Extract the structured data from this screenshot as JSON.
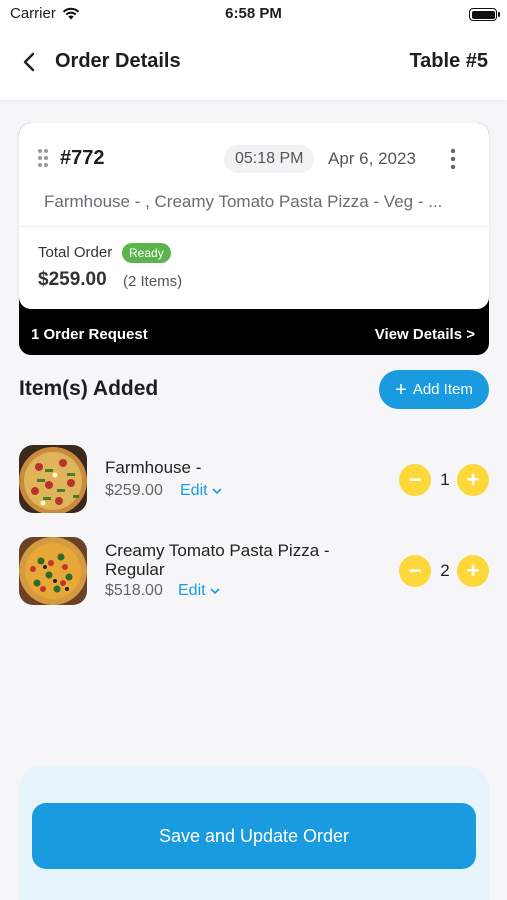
{
  "status_bar": {
    "carrier": "Carrier",
    "time": "6:58 PM"
  },
  "header": {
    "title": "Order Details",
    "table": "Table #5"
  },
  "order": {
    "number": "#772",
    "time": "05:18 PM",
    "date": "Apr 6, 2023",
    "items_summary": "Farmhouse - , Creamy Tomato Pasta Pizza - Veg - ...",
    "total_label": "Total Order",
    "status_badge": "Ready",
    "total_amount": "$259.00",
    "item_count": "(2 Items)",
    "request_label": "1 Order Request",
    "view_details": "View Details >"
  },
  "section": {
    "title": "Item(s) Added",
    "add_button": "Add Item"
  },
  "items": [
    {
      "name": "Farmhouse -",
      "price": "$259.00",
      "edit": "Edit",
      "qty": "1"
    },
    {
      "name": "Creamy Tomato Pasta Pizza - Regular",
      "price": "$518.00",
      "edit": "Edit",
      "qty": "2"
    }
  ],
  "footer": {
    "save_button": "Save and Update Order"
  },
  "colors": {
    "accent": "#1a9be0",
    "ready": "#5bb54b",
    "stepper": "#fcd83b"
  }
}
